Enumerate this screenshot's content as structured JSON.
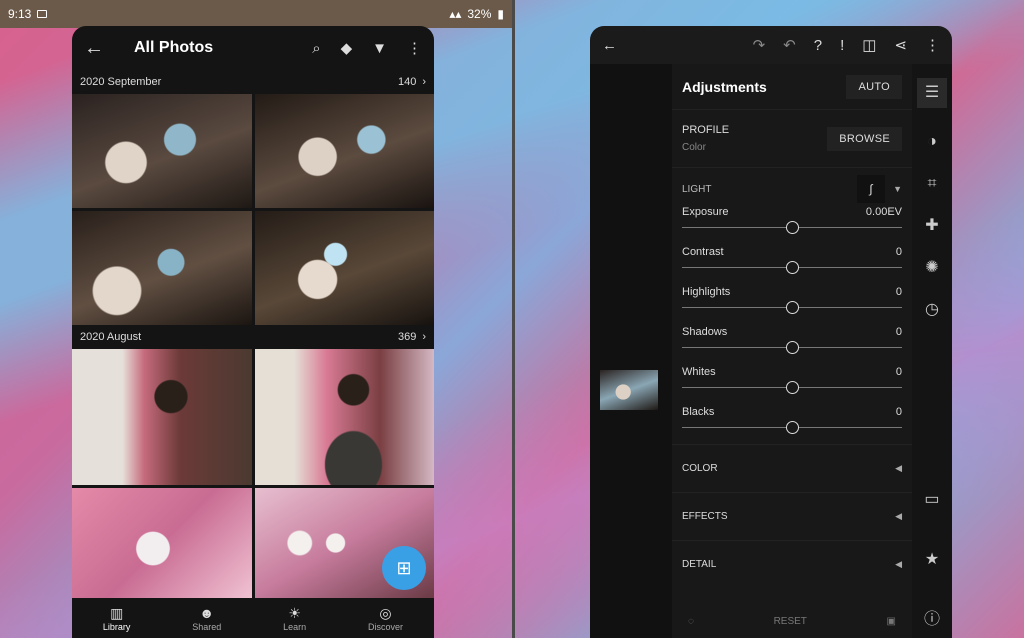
{
  "status_bar": {
    "time": "9:13",
    "battery": "32%"
  },
  "library": {
    "title": "All Photos",
    "sections": [
      {
        "label": "2020 September",
        "count": "140"
      },
      {
        "label": "2020 August",
        "count": "369"
      }
    ],
    "nav": [
      {
        "label": "Library",
        "icon": "library-icon"
      },
      {
        "label": "Shared",
        "icon": "people-icon"
      },
      {
        "label": "Learn",
        "icon": "lightbulb-icon"
      },
      {
        "label": "Discover",
        "icon": "globe-icon"
      }
    ]
  },
  "editor": {
    "panel_title": "Adjustments",
    "auto_label": "AUTO",
    "profile": {
      "label": "PROFILE",
      "value": "Color",
      "browse_label": "BROWSE"
    },
    "light_label": "LIGHT",
    "sliders": [
      {
        "label": "Exposure",
        "value": "0.00EV",
        "level": 0.5
      },
      {
        "label": "Contrast",
        "value": "0",
        "level": 0.5
      },
      {
        "label": "Highlights",
        "value": "0",
        "level": 0.5
      },
      {
        "label": "Shadows",
        "value": "0",
        "level": 0.5
      },
      {
        "label": "Whites",
        "value": "0",
        "level": 0.5
      },
      {
        "label": "Blacks",
        "value": "0",
        "level": 0.5
      }
    ],
    "sections": [
      "COLOR",
      "EFFECTS",
      "DETAIL"
    ],
    "reset_label": "RESET"
  }
}
